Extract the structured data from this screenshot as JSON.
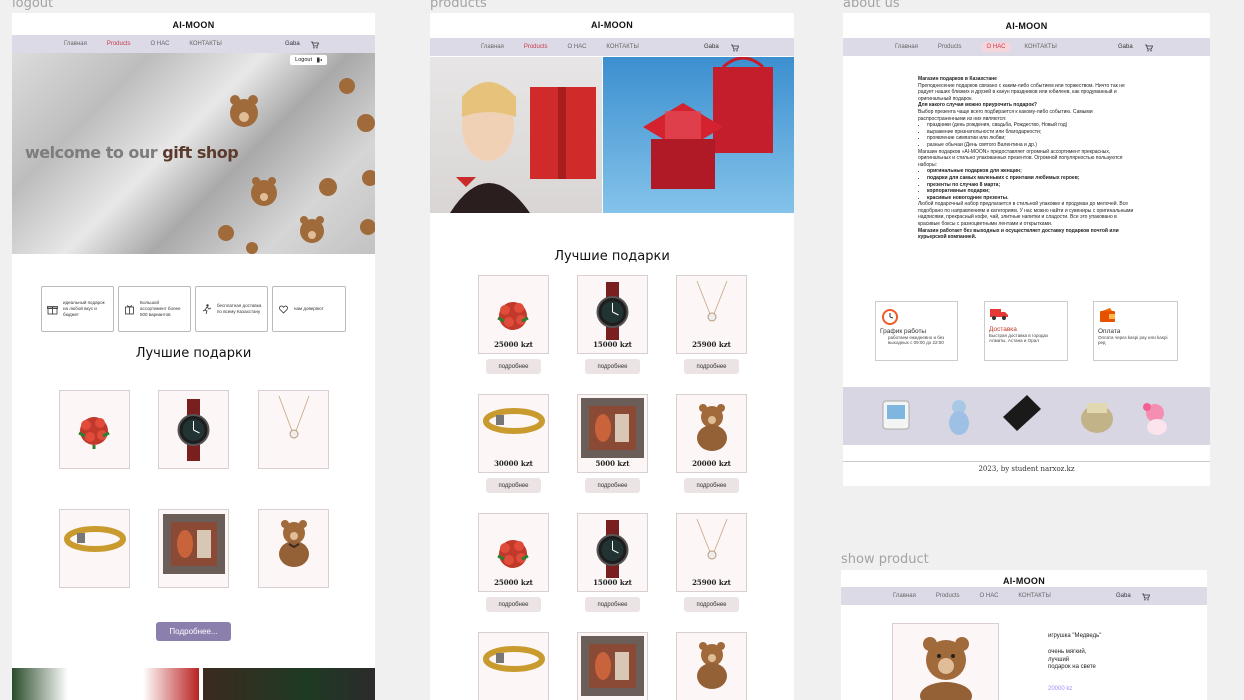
{
  "brand": "AI-MOON",
  "frames": {
    "logout": {
      "label": "logout"
    },
    "products": {
      "label": "products"
    },
    "about": {
      "label": "about us"
    },
    "show": {
      "label": "show product"
    }
  },
  "nav": {
    "home": "Главная",
    "products": "Products",
    "about": "О НАС",
    "contacts": "КОНТАКТЫ",
    "user": "Gaba"
  },
  "logout_frame": {
    "logout_label": "Logout",
    "hero_welcome": "welcome to our",
    "hero_gift": "gift shop",
    "features": [
      "идеальный подарок на любой вкус и бюджет",
      "Большой ассортимент более 500 вариантов",
      "бесплатная доставка по всему Казахстану",
      "нам доверяют"
    ],
    "best_heading": "Лучшие подарки",
    "more_button": "Подробнее..."
  },
  "products_frame": {
    "best_heading": "Лучшие подарки",
    "more_label": "подробнее",
    "rows": [
      [
        "25000 kzt",
        "15000 kzt",
        "25900 kzt"
      ],
      [
        "30000 kzt",
        "5000 kzt",
        "20000 kzt"
      ],
      [
        "25000 kzt",
        "15000 kzt",
        "25900 kzt"
      ]
    ]
  },
  "about_frame": {
    "title": "Магазин подарков в Казахстане",
    "para1": "Преподнесение подарков связано с каким-либо событием или торжеством. Ничто так не радует наших близких и друзей в канун праздников или юбилеев, как продуманный и оригинальный подарок.",
    "q1": "Для какого случая можно приурочить подарок?",
    "para2": "Выбор презента чаще всего подбирается к какому-либо событию. Самыми распространенными из них являются:",
    "list1": [
      "праздники (день рождения, свадьба, Рождество, Новый год)",
      "выражение признательности или благодарности;",
      "проявление симпатии или любви;",
      "разные обычаи (День святого Валентина и др.)"
    ],
    "para3": "Магазин подарков «AI-MOON» предоставляет огромный ассортимент прекрасных, оригинальных и стильно упакованных презентов. Огромной популярностью пользуются наборы:",
    "list2": [
      "оригинальные подарков для женщин;",
      "подарки для самых маленьких с принтами любимых героев;",
      "презенты по случаю 8 марта;",
      "корпоративные подарки;",
      "красивые новогодние презенты."
    ],
    "para4": "Любой подарочный набор предлагается в стильной упаковке и продуман до мелочей. Все подобрано по направлениям и категориям. У нас можно найти и сувениры с оригинальными надписями, прекрасный кофе, чай, элитные напитки и сладости. Все это упаковано в красивые боксы с разноцветными лентами и открытками.",
    "para5": "Магазин работает без выходных и осуществляет доставку подарков почтой или курьерской компанией.",
    "cards": [
      {
        "title": "График работы",
        "text": "работаем ежедневно и без выходных с 09:00 до 22:00"
      },
      {
        "title": "Доставка",
        "text": "Быстрая доставка в городах Алматы, Астана и Орал"
      },
      {
        "title": "Оплата",
        "text": "Оплата через kaspi pay или kaspi ред"
      }
    ],
    "footer": "2023, by student narxoz.kz"
  },
  "show_frame": {
    "product_name": "игрушка \"Медведь\"",
    "desc": [
      "очень мягкий,",
      "лучший",
      "подарок на свете"
    ],
    "price": "20000 kz"
  }
}
